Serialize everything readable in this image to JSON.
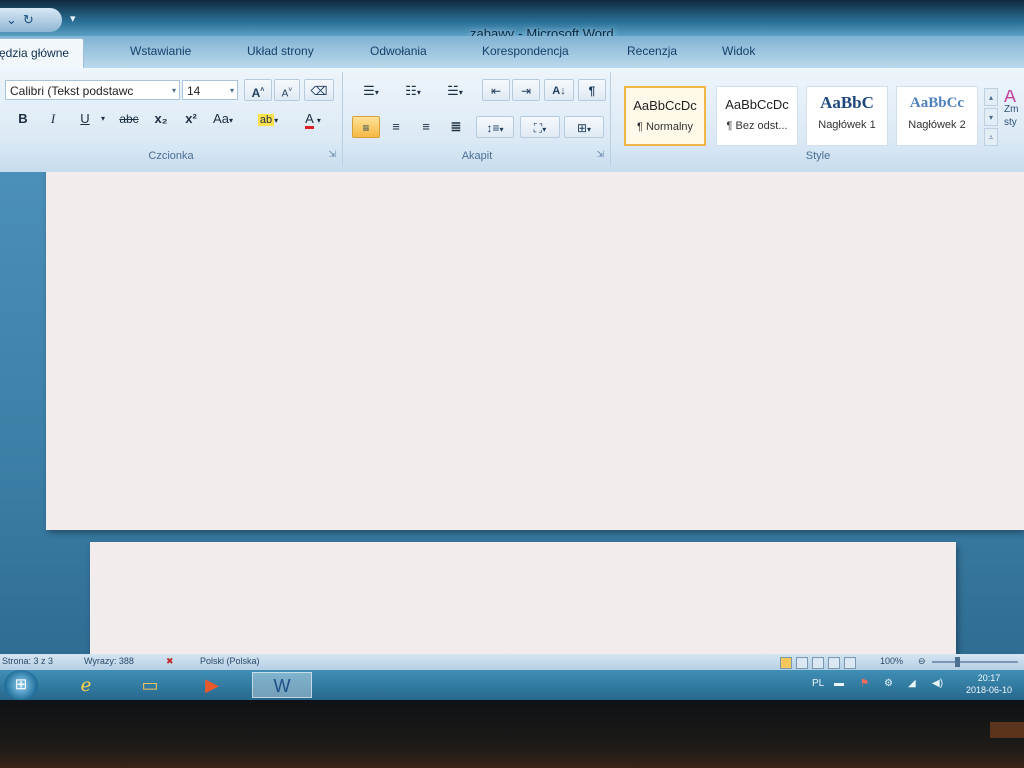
{
  "app": {
    "document_name": "zabawy",
    "separator": "-",
    "app_name": "Microsoft Word"
  },
  "tabs": [
    {
      "label": "ędzia główne",
      "active": true
    },
    {
      "label": "Wstawianie"
    },
    {
      "label": "Układ strony"
    },
    {
      "label": "Odwołania"
    },
    {
      "label": "Korespondencja"
    },
    {
      "label": "Recenzja"
    },
    {
      "label": "Widok"
    }
  ],
  "ribbon": {
    "font_group": {
      "label": "Czcionka",
      "font_name": "Calibri (Tekst podstawc",
      "font_size": "14",
      "grow": "A",
      "shrink": "A",
      "bold": "B",
      "italic": "I",
      "underline": "U",
      "strike": "abc",
      "subscript": "x₂",
      "superscript": "x²",
      "change_case": "Aa",
      "highlight": "ab",
      "font_color": "A",
      "font_color_value": "#e02020",
      "highlight_value": "#ffe14d"
    },
    "paragraph_group": {
      "label": "Akapit",
      "sort": "A↓",
      "show_marks": "¶"
    },
    "styles_group": {
      "label": "Style",
      "styles": [
        {
          "sample": "AaBbCcDc",
          "name": "¶ Normalny",
          "selected": true
        },
        {
          "sample": "AaBbCcDc",
          "name": "¶ Bez odst..."
        },
        {
          "sample": "AaBbC",
          "name": "Nagłówek 1"
        },
        {
          "sample": "AaBbCc",
          "name": "Nagłówek 2"
        }
      ],
      "change_styles": "Zm sty"
    }
  },
  "statusbar": {
    "page": "Strona: 3 z 3",
    "words": "Wyrazy: 388",
    "language": "Polski (Polska)",
    "zoom": "100%"
  },
  "taskbar": {
    "clock_time": "20:17",
    "clock_date": "2018-06-10",
    "tray_lang": "PL"
  }
}
